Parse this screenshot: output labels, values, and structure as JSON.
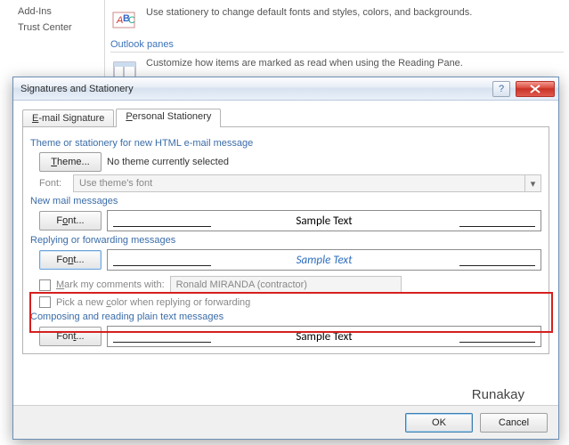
{
  "bg": {
    "side": {
      "addins": "Add-Ins",
      "trust": "Trust Center"
    },
    "stationery_text": "Use stationery to change default fonts and styles, colors, and backgrounds.",
    "panes_header": "Outlook panes",
    "panes_text": "Customize how items are marked as read when using the Reading Pane."
  },
  "dialog": {
    "title": "Signatures and Stationery",
    "tabs": {
      "email_sig": "E-mail Signature",
      "personal": "Personal Stationery",
      "e_u": "E",
      "p_u": "P"
    },
    "theme_section": "Theme or stationery for new HTML e-mail message",
    "theme_btn": "Theme...",
    "no_theme": "No theme currently selected",
    "font_lbl": "Font:",
    "use_theme_font": "Use theme's font",
    "new_mail_section": "New mail messages",
    "font_btn": "Font...",
    "sample": "Sample Text",
    "reply_section": "Replying or forwarding messages",
    "mark_comments": "Mark my comments with:",
    "comment_name": "Ronald MIRANDA (contractor)",
    "pick_color": "Pick a new color when replying or forwarding",
    "compose_section": "Composing and reading plain text messages",
    "ok": "OK",
    "cancel": "Cancel"
  },
  "watermark": "Runakay"
}
